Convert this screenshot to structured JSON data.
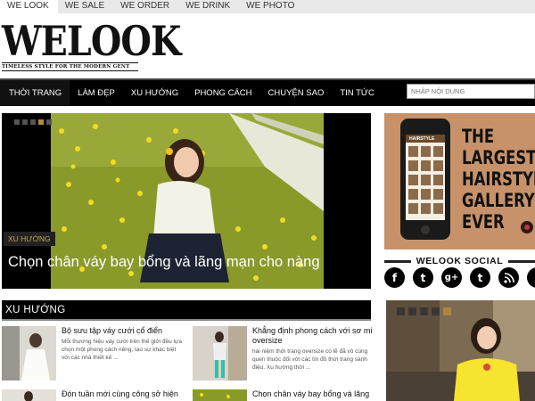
{
  "topbar": {
    "items": [
      "WE LOOK",
      "WE SALE",
      "WE ORDER",
      "WE DRINK",
      "WE PHOTO"
    ]
  },
  "logo": {
    "main": "WELOOK",
    "tagline": "TIMELESS STYLE FOR THE MODERN GENT"
  },
  "nav": {
    "items": [
      "THỜI TRANG",
      "LÀM ĐẸP",
      "XU HƯỚNG",
      "PHONG CÁCH",
      "CHUYỆN SAO",
      "TIN TỨC"
    ],
    "search_placeholder": "NHẬP NỘI DUNG"
  },
  "hero": {
    "tag": "XU HƯỚNG",
    "title": "Chọn chân váy bay bổng và lãng mạn cho nàng"
  },
  "ad": {
    "lines": [
      "THE",
      "LARGEST",
      "HAIRSTYLE",
      "GALLERY",
      "EVER"
    ],
    "phone_header": "HAIRSTYLE"
  },
  "social": {
    "title": "WELOOK SOCIAL",
    "icons": [
      "f",
      "t",
      "g+",
      "t",
      "rss"
    ]
  },
  "section": {
    "title": "XU HƯỚNG"
  },
  "posts": [
    {
      "title": "Bộ sưu tập váy cưới cổ điển",
      "excerpt": "Mỗi thương hiệu váy cưới trên thế giới đều lựa chọn một phong cách riêng, tạo sự khác biệt với các nhà thiết kế ..."
    },
    {
      "title": "Khẳng định phong cách với sơ mi oversize",
      "excerpt": "hái niệm thời trang oversize có lẽ đã vô cùng quen thuộc đối với các tín đồ thời trang sành điệu. Xu hướng thời ..."
    },
    {
      "title": "Đón tuần mới cùng công sở hiện",
      "excerpt": ""
    },
    {
      "title": "Chọn chân váy bay bổng và lãng",
      "excerpt": ""
    }
  ],
  "colors": {
    "accent": "#b48a3c",
    "nav_bg": "#000000"
  }
}
